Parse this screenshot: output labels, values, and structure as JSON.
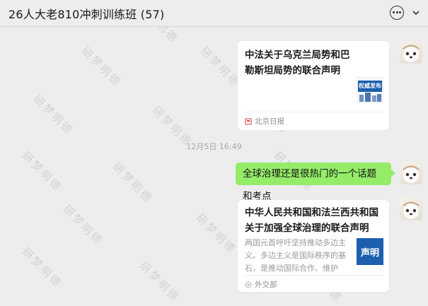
{
  "header": {
    "title": "26人大老810冲刺训练班 (57)",
    "more_icon": "more-dots-icon",
    "chevron_icon": "chevron-down-icon"
  },
  "messages": {
    "card1": {
      "title": "中法关于乌克兰局势和巴勒斯坦局势的联合声明",
      "thumb_text": "权威发布",
      "source": "北京日报"
    },
    "timestamp": "12月5日 16:49",
    "text_bubble": "全球治理还是很热门的一个话题和考点",
    "card2": {
      "title": "中华人民共和国和法兰西共和国关于加强全球治理的联合声明",
      "description": "两国元首呼吁坚持推动多边主义。多边主义是国际秩序的基石，是推动国际合作、维护世...",
      "thumb_text": "声明",
      "source": "外交部"
    }
  },
  "watermark": "研梦明德",
  "colors": {
    "background": "#ededed",
    "bubble_green": "#95ec69",
    "card_white": "#ffffff",
    "thumb_blue": "#1d5fae"
  }
}
